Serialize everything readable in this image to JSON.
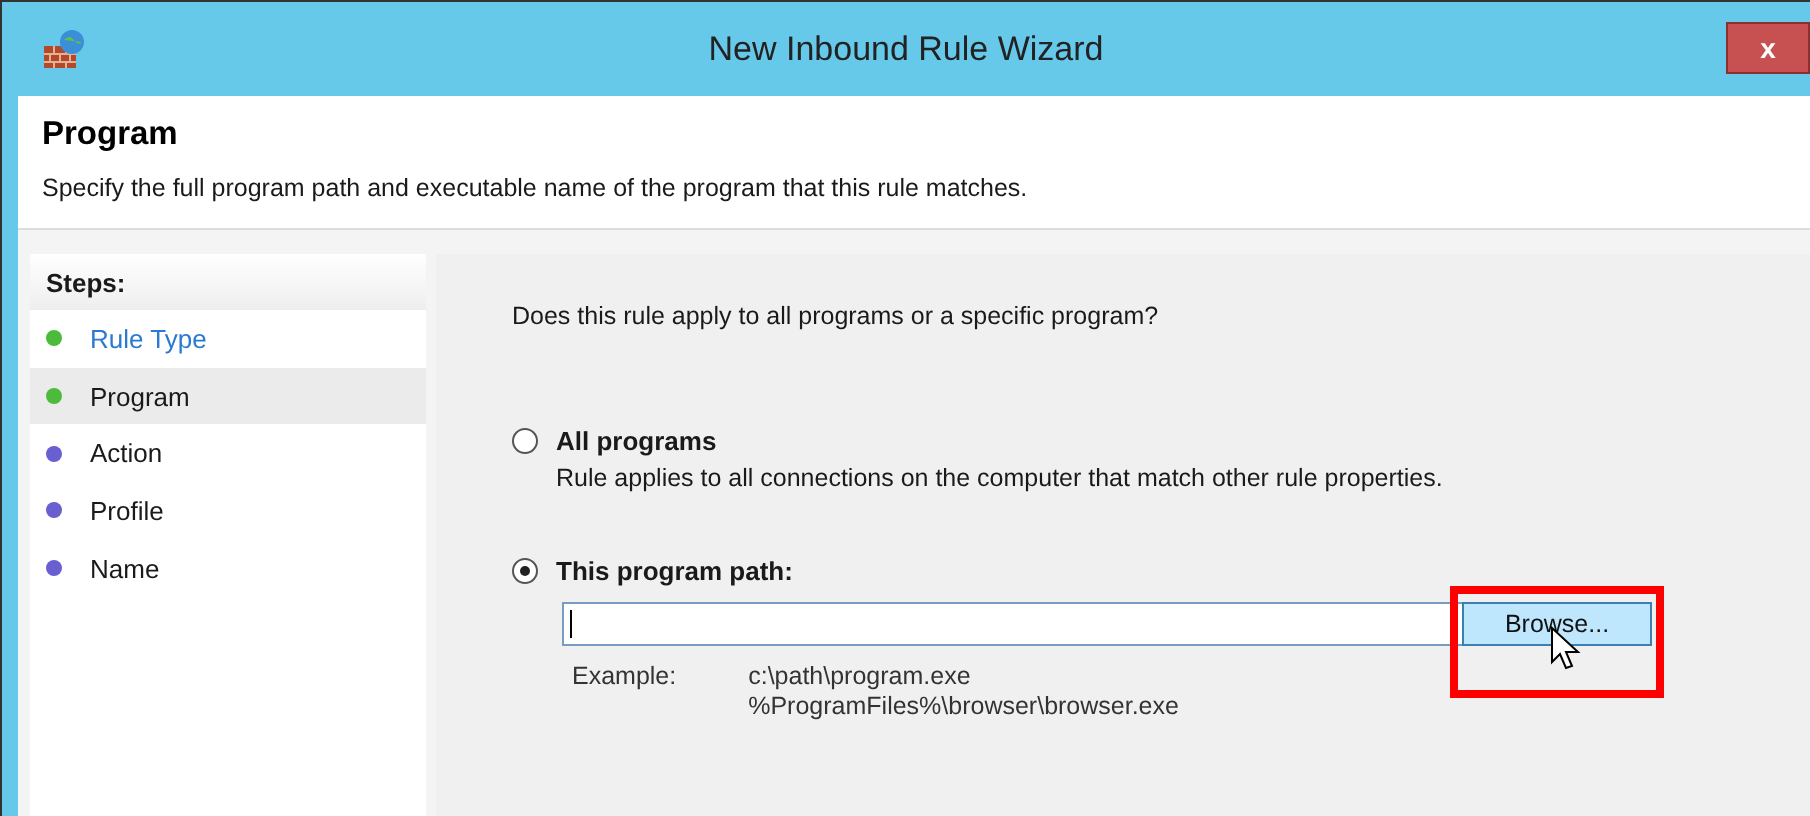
{
  "window": {
    "title": "New Inbound Rule Wizard",
    "close_label": "x"
  },
  "header": {
    "title": "Program",
    "description": "Specify the full program path and executable name of the program that this rule matches."
  },
  "steps": {
    "heading": "Steps:",
    "items": [
      {
        "label": "Rule Type",
        "color": "#4cbb3c",
        "link": true,
        "selected": false
      },
      {
        "label": "Program",
        "color": "#4cbb3c",
        "link": false,
        "selected": true
      },
      {
        "label": "Action",
        "color": "#6a5fd0",
        "link": false,
        "selected": false
      },
      {
        "label": "Profile",
        "color": "#6a5fd0",
        "link": false,
        "selected": false
      },
      {
        "label": "Name",
        "color": "#6a5fd0",
        "link": false,
        "selected": false
      }
    ]
  },
  "question": "Does this rule apply to all programs or a specific program?",
  "options": [
    {
      "label": "All programs",
      "description": "Rule applies to all connections on the computer that match other rule properties.",
      "selected": false
    },
    {
      "label": "This program path:",
      "selected": true
    }
  ],
  "path_field": {
    "browse_button": "Browse...",
    "highlighted": true
  },
  "example": {
    "label": "Example:",
    "lines": [
      "c:\\path\\program.exe",
      "%ProgramFiles%\\browser\\browser.exe"
    ]
  }
}
